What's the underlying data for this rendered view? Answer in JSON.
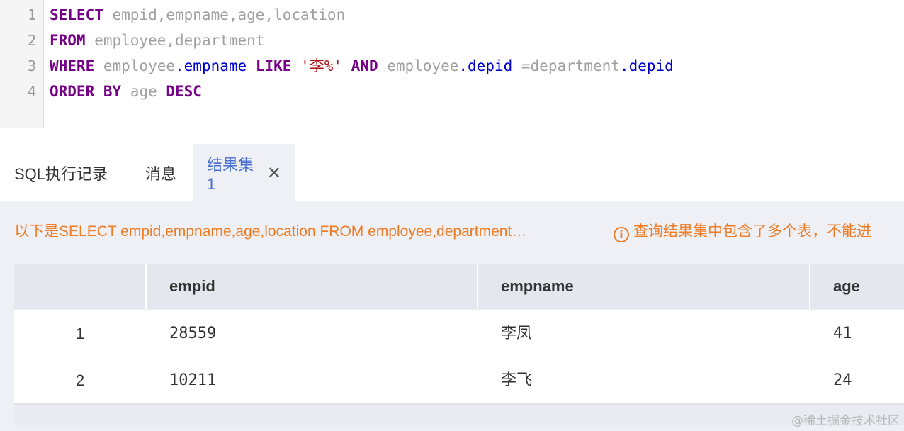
{
  "editor": {
    "line_numbers": [
      "1",
      "2",
      "3",
      "4"
    ],
    "lines": [
      [
        {
          "t": "SELECT",
          "c": "kw"
        },
        {
          "t": " empid,empname,age,location",
          "c": "id"
        }
      ],
      [
        {
          "t": "FROM",
          "c": "kw"
        },
        {
          "t": " employee,department",
          "c": "id"
        }
      ],
      [
        {
          "t": "WHERE",
          "c": "kw"
        },
        {
          "t": " employee",
          "c": "id"
        },
        {
          "t": ".empname",
          "c": "prop"
        },
        {
          "t": " ",
          "c": "id"
        },
        {
          "t": "LIKE",
          "c": "kw"
        },
        {
          "t": " ",
          "c": "id"
        },
        {
          "t": "'李%'",
          "c": "str"
        },
        {
          "t": " ",
          "c": "id"
        },
        {
          "t": "AND",
          "c": "kw"
        },
        {
          "t": " employee",
          "c": "id"
        },
        {
          "t": ".depid",
          "c": "prop"
        },
        {
          "t": " =department",
          "c": "id"
        },
        {
          "t": ".depid",
          "c": "prop"
        }
      ],
      [
        {
          "t": "ORDER BY",
          "c": "kw"
        },
        {
          "t": " age ",
          "c": "id"
        },
        {
          "t": "DESC",
          "c": "kw"
        }
      ]
    ]
  },
  "tabs": {
    "history": "SQL执行记录",
    "messages": "消息",
    "result": "结果集1",
    "close_glyph": "✕",
    "close_icon": "close-icon",
    "active_color": "#4a6fd1"
  },
  "result": {
    "message": "以下是SELECT empid,empname,age,location FROM employee,department…",
    "warning_icon": "info-icon",
    "warning_glyph": "i",
    "warning": "查询结果集中包含了多个表，不能进",
    "message_color": "#f07b23",
    "columns": [
      "empid",
      "empname",
      "age"
    ],
    "rows": [
      {
        "index": "1",
        "empid": "28559",
        "empname": "李凤",
        "age": "41"
      },
      {
        "index": "2",
        "empid": "10211",
        "empname": "李飞",
        "age": "24"
      }
    ]
  },
  "watermark": "@稀土掘金技术社区"
}
